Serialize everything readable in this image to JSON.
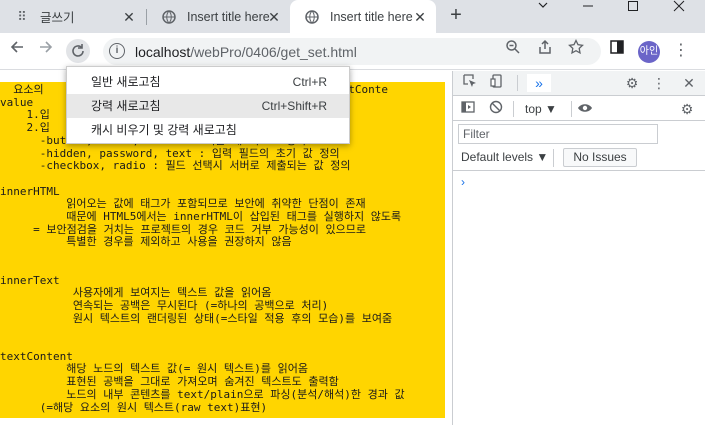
{
  "tabs": [
    {
      "title": "글쓰기",
      "icon": "grid-dots-icon"
    },
    {
      "title": "Insert title here",
      "icon": "globe-icon"
    },
    {
      "title": "Insert title here",
      "icon": "globe-icon"
    }
  ],
  "new_tab_glyph": "+",
  "window_controls": {
    "minimize": "⌄ —",
    "restore": "☐",
    "close": "✕"
  },
  "address": {
    "host": "localhost",
    "path": "/webPro/0406/get_set.html"
  },
  "profile": {
    "initial": "아인",
    "color": "#6b65c8"
  },
  "context_menu": [
    {
      "label": "일반 새로고침",
      "shortcut": "Ctrl+R"
    },
    {
      "label": "강력 새로고침",
      "shortcut": "Ctrl+Shift+R"
    },
    {
      "label": "캐시 비우기 및 강력 새로고침",
      "shortcut": ""
    }
  ],
  "page_lines": [
    "  요소의                                  nerText, textConte",
    "value",
    "    1.입",
    "    2.입",
    "      -button, reset, submit : 버튼 내 텍스트 정의",
    "      -hidden, password, text : 입력 필드의 초기 값 정의",
    "      -checkbox, radio : 필드 선택시 서버로 제출되는 값 정의",
    "",
    "innerHTML",
    "          읽어오는 값에 태그가 포함되므로 보안에 취약한 단점이 존재",
    "          때문에 HTML5에서는 innerHTML이 삽입된 태그를 실행하지 않도록",
    "     = 보안점검을 거치는 프로젝트의 경우 코드 거부 가능성이 있으므로",
    "          특별한 경우를 제외하고 사용을 권장하지 않음",
    "",
    "",
    "innerText",
    "           사용자에게 보여지는 텍스트 값을 읽어옴",
    "           연속되는 공백은 무시된다 (=하나의 공백으로 처리)",
    "           원시 텍스트의 랜더링된 상태(=스타일 적용 후의 모습)를 보여줌",
    "",
    "",
    "textContent",
    "          해당 노드의 텍스트 값(= 원시 텍스트)를 읽어옴",
    "          표현된 공백을 그대로 가져오며 숨겨진 텍스트도 출력함",
    "          노드의 내부 콘텐츠를 text/plain으로 파싱(분석/해석)한 경과 값",
    "      (=해당 요소의 원시 텍스트(raw text)표현)"
  ],
  "devtools": {
    "panel_tab": "»",
    "context": "top ▼",
    "filter_placeholder": "Filter",
    "levels": "Default levels ▼",
    "issues": "No Issues",
    "prompt": "›"
  },
  "colors": {
    "highlight": "#ffd500",
    "tabstrip": "#dee1e6"
  }
}
